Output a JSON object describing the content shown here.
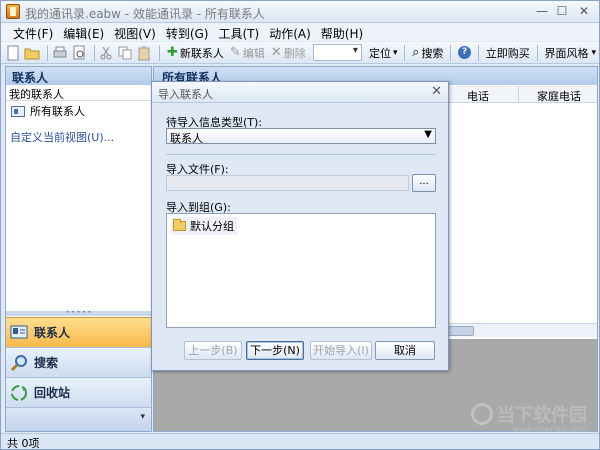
{
  "window": {
    "title": "我的通讯录.eabw - 效能通讯录 - 所有联系人",
    "controls": [
      "—",
      "☐",
      "✕"
    ]
  },
  "menu": [
    "文件(F)",
    "编辑(E)",
    "视图(V)",
    "转到(G)",
    "工具(T)",
    "动作(A)",
    "帮助(H)"
  ],
  "toolbar": {
    "new_contact": "新联系人",
    "edit": "编辑",
    "delete": "删除",
    "locate": "定位",
    "search": "搜索",
    "buy": "立即购买",
    "theme": "界面风格"
  },
  "left_pane": {
    "header": "联系人",
    "my_contacts": "我的联系人",
    "all_contacts": "所有联系人",
    "custom_view": "自定义当前视图(U)...",
    "nav": [
      {
        "label": "联系人",
        "icon": "contacts-icon",
        "active": true
      },
      {
        "label": "搜索",
        "icon": "search-icon",
        "active": false
      },
      {
        "label": "回收站",
        "icon": "recycle-icon",
        "active": false
      }
    ]
  },
  "right_pane": {
    "header": "所有联系人",
    "columns": [
      "电话",
      "家庭电话"
    ]
  },
  "status": {
    "count": "共 0项"
  },
  "dialog": {
    "title": "导入联系人",
    "type_label": "待导入信息类型(T):",
    "type_value": "联系人",
    "file_label": "导入文件(F):",
    "file_value": "",
    "browse": "...",
    "group_label": "导入到组(G):",
    "group_item": "默认分组",
    "buttons": {
      "prev": "上一步(B)",
      "next": "下一步(N)",
      "start": "开始导入(I)",
      "cancel": "取消"
    }
  },
  "watermark": {
    "text": "当下软件园",
    "sub": "www.downxia.com"
  },
  "colors": {
    "accent": "#f8b94a",
    "panel": "#dfe9f6",
    "header": "#b3cbea",
    "link": "#2b4fa8"
  }
}
